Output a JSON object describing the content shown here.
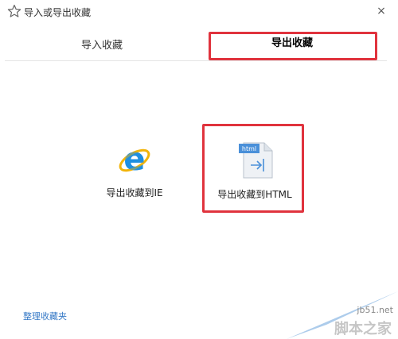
{
  "window": {
    "title": "导入或导出收藏",
    "close_glyph": "×"
  },
  "tabs": [
    {
      "label": "导入收藏",
      "active": false
    },
    {
      "label": "导出收藏",
      "active": true,
      "highlighted": true
    }
  ],
  "options": [
    {
      "label": "导出收藏到IE",
      "icon": "ie-icon"
    },
    {
      "label": "导出收藏到HTML",
      "icon": "html-file-icon",
      "icon_badge": "html",
      "highlighted": true
    }
  ],
  "footer": {
    "link_label": "整理收藏夹"
  },
  "watermark": {
    "site": "jb51.net",
    "brand": "脚本之家"
  },
  "colors": {
    "highlight": "#e0333d",
    "link": "#3478c6",
    "ie_blue": "#1f8fe0",
    "ie_ring": "#f2b40a"
  }
}
